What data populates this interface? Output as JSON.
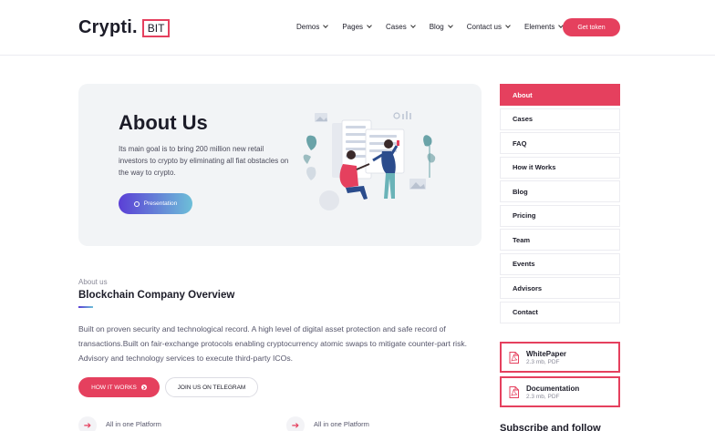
{
  "header": {
    "logo_text": "Crypti.",
    "logo_box": "BIT",
    "nav": [
      "Demos",
      "Pages",
      "Cases",
      "Blog",
      "Contact us",
      "Elements"
    ],
    "cta": "Get token"
  },
  "hero": {
    "title": "About Us",
    "text": "Its main goal is to bring 200 million new retail investors to crypto by eliminating all fiat obstacles on the way to crypto.",
    "button": "Presentation"
  },
  "section": {
    "eyebrow": "About us",
    "title": "Blockchain Company Overview",
    "paragraph": "Built on proven security and technological record. A high level of digital asset protection and safe record of transactions.Built on fair-exchange protocols enabling cryptocurrency atomic swaps to mitigate counter-part risk. Advisory and technology services to execute third-party ICOs.",
    "btn_primary": "HOW IT WORKS",
    "btn_secondary": "JOIN US ON TELEGRAM",
    "features": [
      "All in one Platform",
      "All in one Platform"
    ]
  },
  "sidebar": {
    "items": [
      "About",
      "Cases",
      "FAQ",
      "How it Works",
      "Blog",
      "Pricing",
      "Team",
      "Events",
      "Advisors",
      "Contact"
    ],
    "active_index": 0,
    "docs": [
      {
        "title": "WhitePaper",
        "meta": "2.3 mb, PDF"
      },
      {
        "title": "Documentation",
        "meta": "2.3 mb, PDF"
      }
    ],
    "subscribe_title": "Subscribe and follow"
  },
  "colors": {
    "accent": "#e5405e",
    "gradient_start": "#5b3fd6",
    "gradient_end": "#6dbfd8"
  },
  "icons": {
    "presentation": "chat-bubble-icon",
    "doc": "pdf-file-icon",
    "feature": "arrow-right-icon"
  }
}
